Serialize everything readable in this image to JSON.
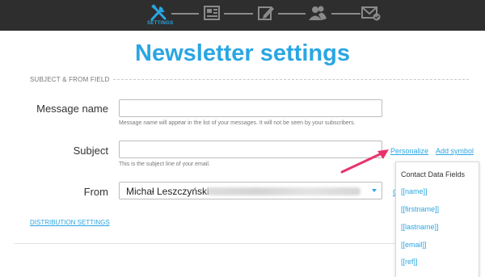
{
  "wizard": {
    "steps": [
      {
        "icon": "settings-tools-icon",
        "label": "SETTINGS",
        "active": true
      },
      {
        "icon": "template-icon",
        "active": false
      },
      {
        "icon": "editor-icon",
        "active": false
      },
      {
        "icon": "recipients-icon",
        "active": false
      },
      {
        "icon": "send-icon",
        "active": false
      }
    ]
  },
  "colors": {
    "accent": "#2aa6e3",
    "arrow": "#e8336d",
    "topbar": "#2e2e2e"
  },
  "page": {
    "title": "Newsletter settings"
  },
  "section": {
    "header": "SUBJECT & FROM FIELD"
  },
  "fields": {
    "message_name": {
      "label": "Message name",
      "value": "",
      "hint": "Message name will appear in the list of your messages. It will not be seen by your subscribers."
    },
    "subject": {
      "label": "Subject",
      "value": "",
      "hint": "This is the subject line of your email."
    },
    "from": {
      "label": "From",
      "value": "Michał Leszczyński"
    }
  },
  "links": {
    "personalize": "Personalize",
    "add_symbol": "Add symbol",
    "partial_c": "C",
    "distribution_settings": "DISTRIBUTION SETTINGS"
  },
  "dropdown": {
    "header": "Contact Data Fields",
    "items": [
      "[[name]]",
      "[[firstname]]",
      "[[lastname]]",
      "[[email]]",
      "[[ref]]"
    ]
  }
}
